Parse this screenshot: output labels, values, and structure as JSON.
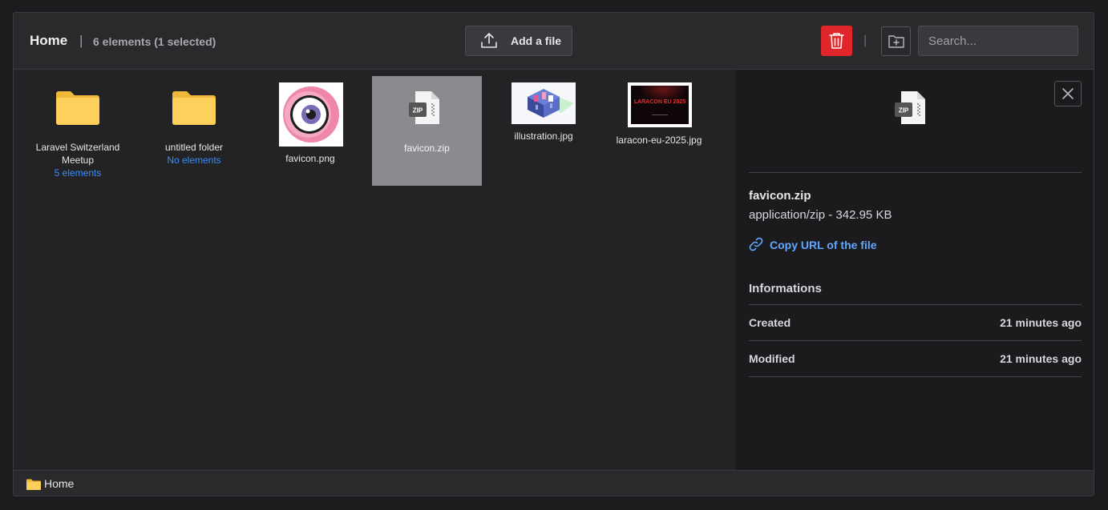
{
  "header": {
    "title": "Home",
    "separator": "|",
    "count": "6 elements (1 selected)",
    "add_label": "Add a file",
    "search_placeholder": "Search..."
  },
  "items": [
    {
      "name": "Laravel Switzerland Meetup",
      "sub": "5 elements",
      "type": "folder"
    },
    {
      "name": "untitled folder",
      "sub": "No elements",
      "type": "folder"
    },
    {
      "name": "favicon.png",
      "type": "image"
    },
    {
      "name": "favicon.zip",
      "type": "zip",
      "selected": true
    },
    {
      "name": "illustration.jpg",
      "type": "image"
    },
    {
      "name": "laracon-eu-2025.jpg",
      "type": "image",
      "thumb_text": "LARACON EU 2025"
    }
  ],
  "panel": {
    "file_name": "favicon.zip",
    "file_meta": "application/zip - 342.95 KB",
    "copy_label": "Copy URL of the file",
    "info_title": "Informations",
    "rows": [
      {
        "label": "Created",
        "value": "21 minutes ago"
      },
      {
        "label": "Modified",
        "value": "21 minutes ago"
      }
    ]
  },
  "footer": {
    "crumb": "Home"
  },
  "colors": {
    "accent": "#3b8cf5",
    "danger": "#e0262a",
    "folder": "#fcc94a",
    "selected": "#8b8b8f"
  }
}
